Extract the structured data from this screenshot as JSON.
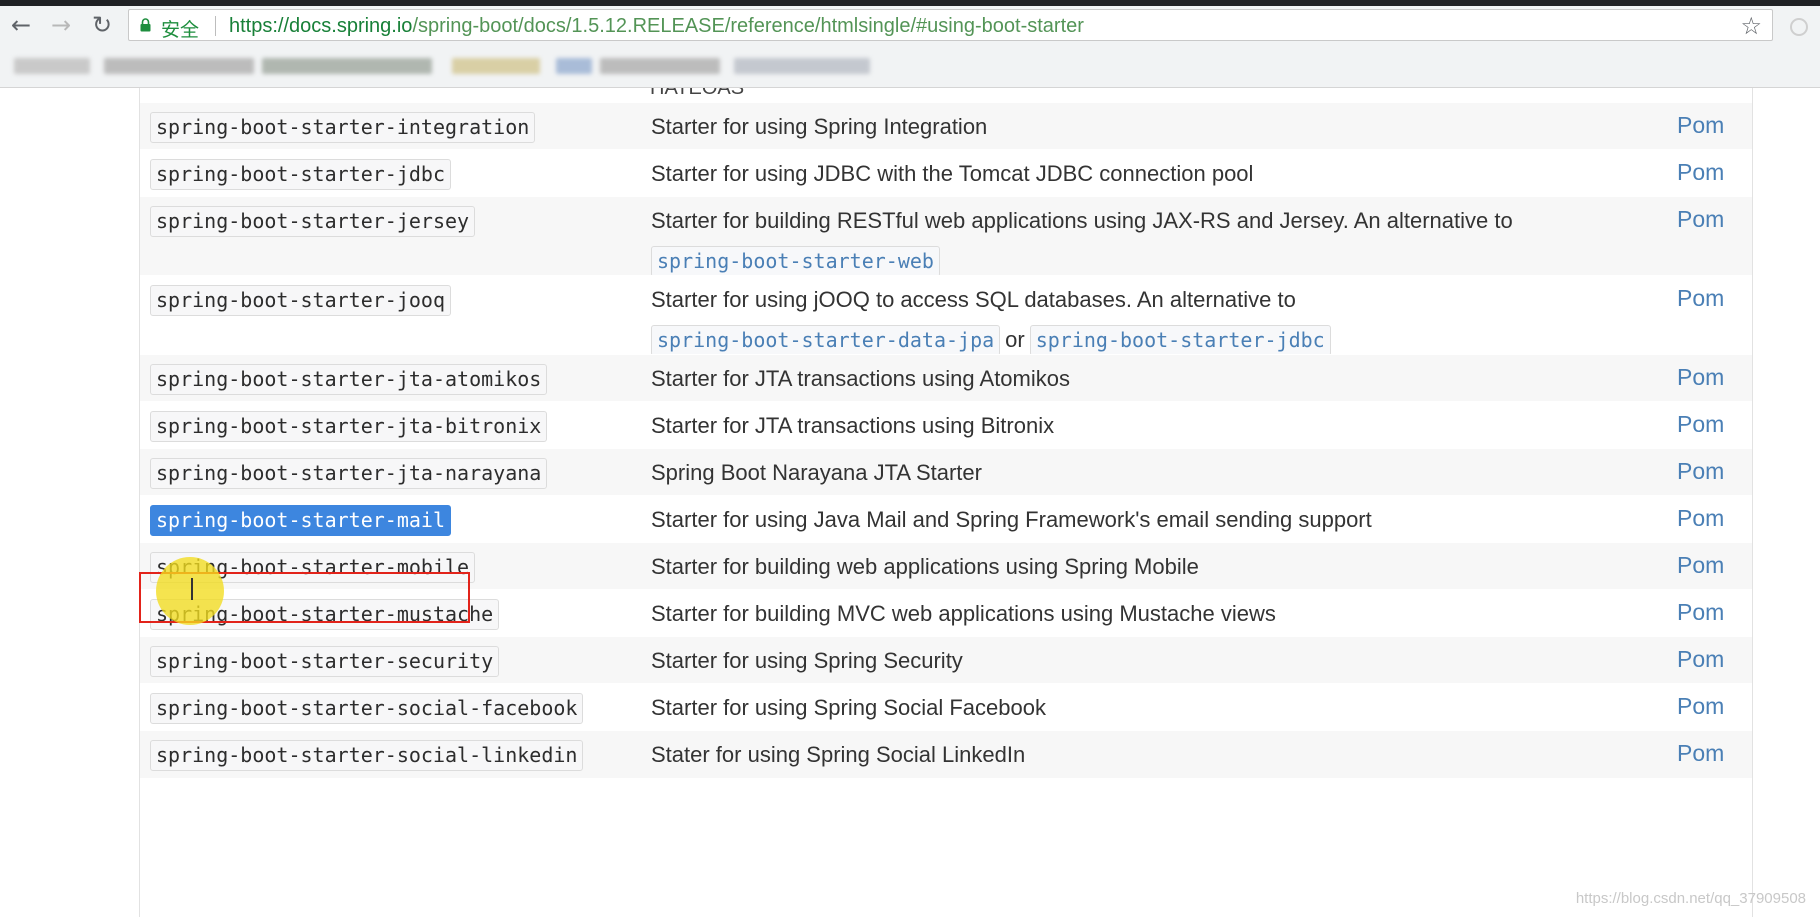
{
  "browser": {
    "secure_label": "安全",
    "url_host": "https://docs.spring.io",
    "url_path": "/spring-boot/docs/1.5.12.RELEASE/reference/htmlsingle/#using-boot-starter"
  },
  "partial_top_text": "HATEOAS",
  "pom_label": "Pom",
  "or_word": "or",
  "rows": [
    {
      "name": "spring-boot-starter-integration",
      "desc": "Starter for using Spring Integration"
    },
    {
      "name": "spring-boot-starter-jdbc",
      "desc": "Starter for using JDBC with the Tomcat JDBC connection pool"
    },
    {
      "name": "spring-boot-starter-jersey",
      "desc": "Starter for building RESTful web applications using JAX-RS and Jersey. An alternative to",
      "alt1": "spring-boot-starter-web"
    },
    {
      "name": "spring-boot-starter-jooq",
      "desc": "Starter for using jOOQ to access SQL databases. An alternative to",
      "alt1": "spring-boot-starter-data-jpa",
      "alt2": "spring-boot-starter-jdbc"
    },
    {
      "name": "spring-boot-starter-jta-atomikos",
      "desc": "Starter for JTA transactions using Atomikos"
    },
    {
      "name": "spring-boot-starter-jta-bitronix",
      "desc": "Starter for JTA transactions using Bitronix"
    },
    {
      "name": "spring-boot-starter-jta-narayana",
      "desc": "Spring Boot Narayana JTA Starter"
    },
    {
      "name": "spring-boot-starter-mail",
      "desc": "Starter for using Java Mail and Spring Framework's email sending support",
      "selected": true
    },
    {
      "name": "spring-boot-starter-mobile",
      "desc": "Starter for building web applications using Spring Mobile"
    },
    {
      "name": "spring-boot-starter-mustache",
      "desc": "Starter for building MVC web applications using Mustache views"
    },
    {
      "name": "spring-boot-starter-security",
      "desc": "Starter for using Spring Security"
    },
    {
      "name": "spring-boot-starter-social-facebook",
      "desc": "Starter for using Spring Social Facebook"
    },
    {
      "name": "spring-boot-starter-social-linkedin",
      "desc": "Stater for using Spring Social LinkedIn"
    }
  ],
  "watermark": "https://blog.csdn.net/qq_37909508",
  "colors": {
    "link": "#4a7fb5",
    "selection": "#3d86df",
    "highlight_box": "#e2231a",
    "cursor_halo": "#f2dc1e",
    "secure_green": "#1e8e3e"
  }
}
